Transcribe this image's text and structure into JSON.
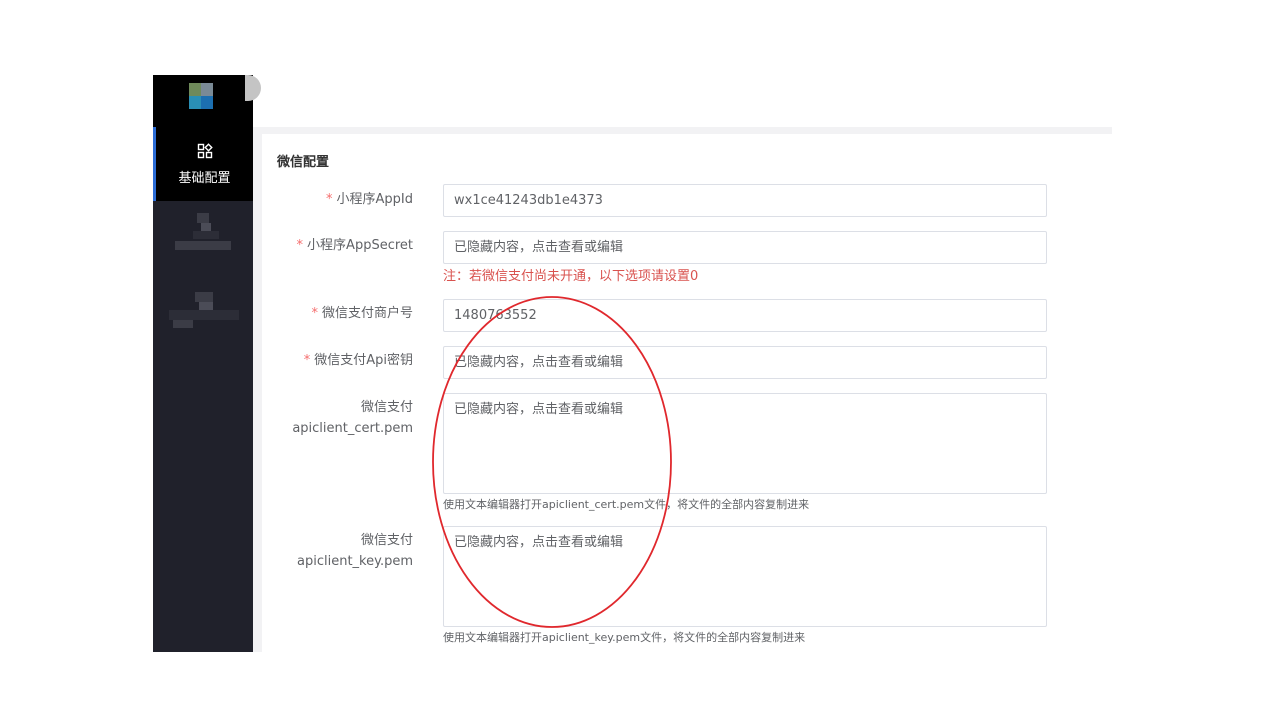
{
  "sidebar": {
    "active_item": {
      "label": "基础配置",
      "icon": "grid-icon"
    },
    "logo_colors": [
      "#6f8a5a",
      "#7a8a96",
      "#2a8fb5",
      "#1c6fb0"
    ],
    "accent": "#2b6cd6"
  },
  "form": {
    "section_title": "微信配置",
    "required_mark": "*",
    "fields": [
      {
        "label": "小程序AppId",
        "required": true,
        "value": "wx1ce41243db1e4373"
      },
      {
        "label": "小程序AppSecret",
        "required": true,
        "value": "已隐藏内容，点击查看或编辑"
      },
      {
        "label": "微信支付商户号",
        "required": true,
        "value": "1480763552"
      },
      {
        "label": "微信支付Api密钥",
        "required": true,
        "value": "已隐藏内容，点击查看或编辑"
      },
      {
        "label_line1": "微信支付",
        "label_line2": "apiclient_cert.pem",
        "required": false,
        "value": "已隐藏内容，点击查看或编辑",
        "hint": "使用文本编辑器打开apiclient_cert.pem文件，将文件的全部内容复制进来"
      },
      {
        "label_line1": "微信支付",
        "label_line2": "apiclient_key.pem",
        "required": false,
        "value": "已隐藏内容，点击查看或编辑",
        "hint": "使用文本编辑器打开apiclient_key.pem文件，将文件的全部内容复制进来"
      }
    ],
    "note": "注：若微信支付尚未开通，以下选项请设置0"
  },
  "annotation": {
    "shape": "ellipse",
    "color": "#e0282d"
  }
}
